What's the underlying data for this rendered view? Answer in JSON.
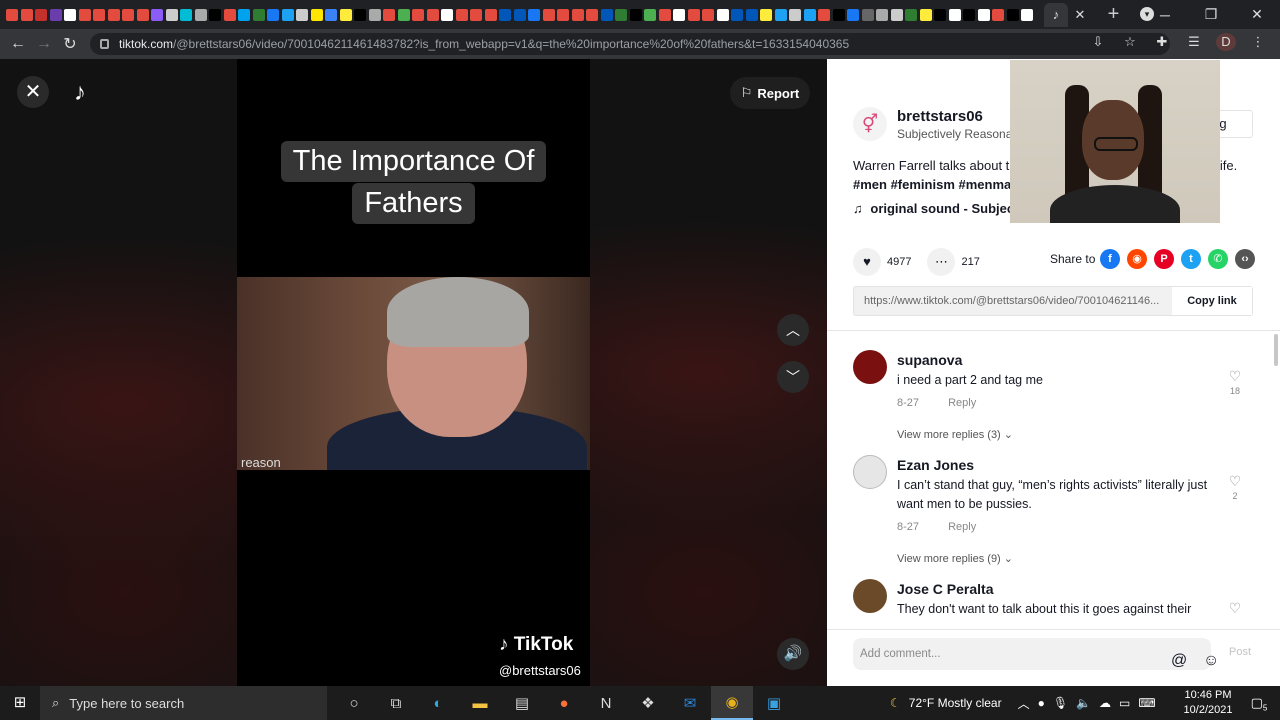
{
  "browser": {
    "tab_colors": [
      "#e34b3e",
      "#e34b3e",
      "#c4302b",
      "#6a3dad",
      "#ffffff",
      "#e34b3e",
      "#e34b3e",
      "#e34b3e",
      "#e34b3e",
      "#e34b3e",
      "#8b5cf6",
      "#cccccc",
      "#00bcd4",
      "#aaaaaa",
      "#000000",
      "#e34b3e",
      "#00a2ed",
      "#2e7d32",
      "#1877f2",
      "#1da1f2",
      "#cccccc",
      "#ffe600",
      "#3b82f6",
      "#ffeb3b",
      "#000000",
      "#aaaaaa",
      "#e34b3e",
      "#4caf50",
      "#e34b3e",
      "#e34b3e",
      "#ffffff",
      "#e34b3e",
      "#e34b3e",
      "#e34b3e",
      "#0057b8",
      "#0057b8",
      "#1877f2",
      "#e34b3e",
      "#e34b3e",
      "#e34b3e",
      "#e34b3e",
      "#0057b8",
      "#2e7d32",
      "#000000",
      "#4caf50",
      "#e34b3e",
      "#ffffff",
      "#e34b3e",
      "#e34b3e",
      "#ffffff",
      "#0057b8",
      "#0057b8",
      "#ffeb3b",
      "#1da1f2",
      "#cccccc",
      "#1da1f2",
      "#e34b3e",
      "#000000",
      "#1877f2",
      "#666666",
      "#aaaaaa",
      "#cccccc",
      "#2e7d32",
      "#ffeb3b",
      "#000000",
      "#ffffff",
      "#000000",
      "#ffffff",
      "#e34b3e",
      "#000000",
      "#ffffff"
    ],
    "active_tab_glyph": "♪",
    "url_host": "tiktok.com",
    "url_path": "/@brettstars06/video/7001046211461483782?is_from_webapp=v1&q=the%20importance%20of%20fathers&t=1633154040365",
    "profile_initial": "D"
  },
  "video": {
    "title_lines": [
      "The Importance Of",
      "Fathers"
    ],
    "clip_watermark": "reason",
    "tiktok_watermark": "TikTok",
    "username_watermark": "@brettstars06",
    "report_label": "Report"
  },
  "panel": {
    "author_name": "brettstars06",
    "author_subtitle": "Subjectively Reasonab",
    "follow_label": "ing",
    "description": "Warren Farrell talks about t",
    "description_end": "life.",
    "hashtags": "#men #feminism #menma",
    "sound": "original sound - Subjec",
    "likes": "4977",
    "comments_count": "217",
    "share_label": "Share to",
    "share_link": "https://www.tiktok.com/@brettstars06/video/700104621146...",
    "copy_link_label": "Copy link",
    "comments": [
      {
        "name": "supanova",
        "text": "i need a part 2 and tag me",
        "date": "8-27",
        "reply": "Reply",
        "likes": "18",
        "replies": "View more replies (3)",
        "avatar_color": "#7a1010"
      },
      {
        "name": "Ezan Jones",
        "text": "I can’t stand that guy, “men’s rights activists” literally just want men to be pussies.",
        "date": "8-27",
        "reply": "Reply",
        "likes": "2",
        "replies": "View more replies (9)",
        "avatar_color": "#dcdcdc"
      },
      {
        "name": "Jose C Peralta",
        "text": "They don't want to talk about this it goes against their",
        "avatar_color": "#6b4a2a"
      }
    ],
    "add_comment_placeholder": "Add comment...",
    "post_label": "Post"
  },
  "taskbar": {
    "search_placeholder": "Type here to search",
    "weather": "72°F  Mostly clear",
    "time": "10:46 PM",
    "date": "10/2/2021",
    "notification_count": "5"
  }
}
